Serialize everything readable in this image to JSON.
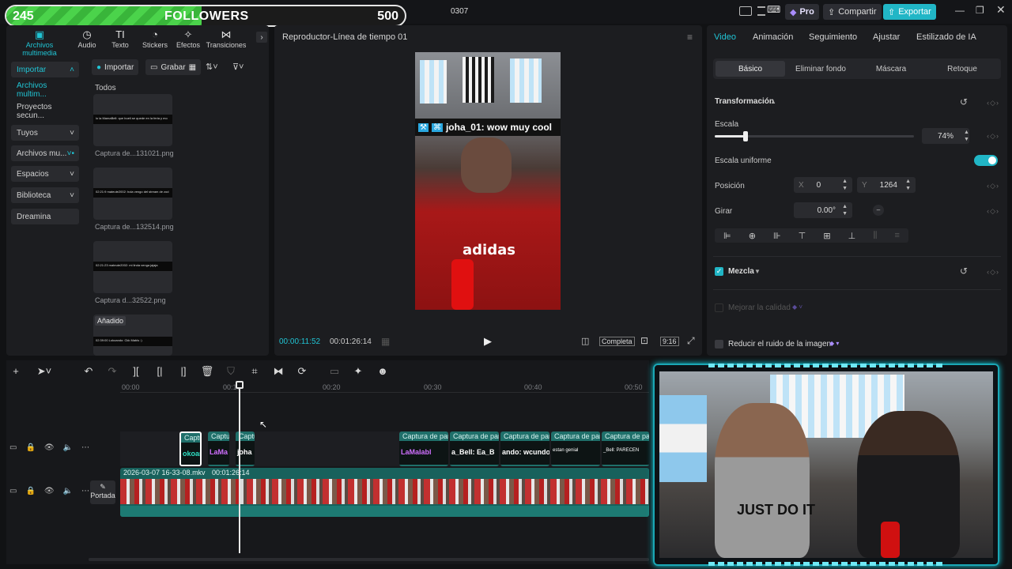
{
  "overlay": {
    "count": "245",
    "label": "FOLLOWERS",
    "goal": "500",
    "progress": 0.49
  },
  "window": {
    "title": "0307",
    "pro": "Pro",
    "share": "Compartir",
    "export": "Exportar"
  },
  "media_tabs": [
    {
      "icon": "media-icon",
      "label": "Archivos multimedia"
    },
    {
      "icon": "audio-icon",
      "label": "Audio"
    },
    {
      "icon": "text-icon",
      "label": "Texto"
    },
    {
      "icon": "stickers-icon",
      "label": "Stickers"
    },
    {
      "icon": "effects-icon",
      "label": "Efectos"
    },
    {
      "icon": "transitions-icon",
      "label": "Transiciones"
    }
  ],
  "sidebar": [
    {
      "label": "Importar"
    },
    {
      "label": "Archivos multim..."
    },
    {
      "label": "Proyectos secun..."
    },
    {
      "label": "Tuyos"
    },
    {
      "label": "Archivos mu..."
    },
    {
      "label": "Espacios"
    },
    {
      "label": "Biblioteca"
    },
    {
      "label": "Dreamina"
    }
  ],
  "media_toolbar": {
    "import": "Importar",
    "record": "Grabar"
  },
  "media_filter": "Todos",
  "media_items": [
    {
      "caption": "Captura de...131021.png",
      "text": "lo la MamaBell: que bueli se quede en la feria y mo"
    },
    {
      "caption": "Captura de...132514.png",
      "text": "02:21:9 mateute2002: hola vengo del stream de zod"
    },
    {
      "caption": "Captura d...32522.png",
      "text": "02:21:23 mateute2002: mi linda venga jajaja"
    },
    {
      "badge": "Añadido",
      "text": "02:39:00 Lokoando: Ckk Mabls :)"
    }
  ],
  "player": {
    "title": "Reproductor-Línea de tiempo 01",
    "current": "00:00:11:52",
    "total": "00:01:26:14",
    "quality": "Completa",
    "ratio": "9:16",
    "chat_msg": "joha_01: wow muy cool"
  },
  "props": {
    "tabs": [
      "Video",
      "Animación",
      "Seguimiento",
      "Ajustar",
      "Estilizado de IA"
    ],
    "subtabs": [
      "Básico",
      "Eliminar fondo",
      "Máscara",
      "Retoque"
    ],
    "transform": "Transformación",
    "scale_label": "Escala",
    "scale_value": "74%",
    "scale_fraction": 0.74,
    "uniform_label": "Escala uniforme",
    "position_label": "Posición",
    "x_label": "X",
    "x_value": "0",
    "y_label": "Y",
    "y_value": "1264",
    "rotate_label": "Girar",
    "rotate_value": "0.00°",
    "blend_label": "Mezcla",
    "enhance_label": "Mejorar la calidad",
    "denoise_label": "Reducir el ruido de la imagen"
  },
  "timeline": {
    "ruler": [
      "00:00",
      "00:10",
      "00:20",
      "00:30",
      "00:40",
      "00:50"
    ],
    "clips": [
      {
        "title": "Captu",
        "name": "okoan"
      },
      {
        "title": "Captu",
        "name": "LaMa"
      },
      {
        "title": "Captu",
        "name": "joha"
      },
      {
        "title": "Captura de par",
        "name": "LaMaIabl"
      },
      {
        "title": "Captura de par",
        "name": "a_Bell: Ea_B"
      },
      {
        "title": "Captura de par",
        "name": "ando: wcundo"
      },
      {
        "title": "Captura de par",
        "name": "estan genial"
      },
      {
        "title": "Captura de par",
        "name": "_Bell: PARECEN"
      }
    ],
    "video_name": "2026-03-07 16-33-08.mkv",
    "video_duration": "00:01:26:14",
    "cover": "Portada"
  }
}
